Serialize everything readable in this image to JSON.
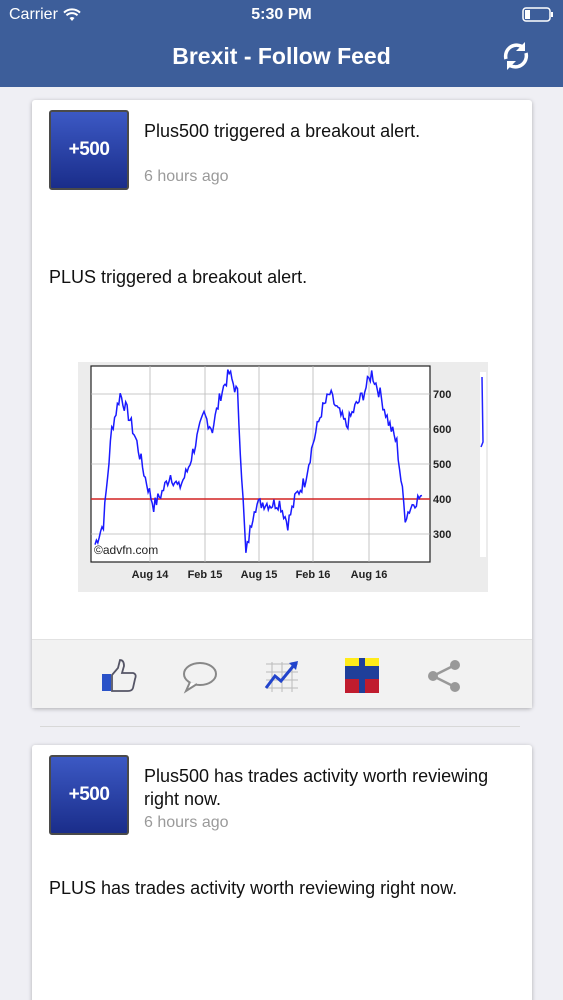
{
  "status": {
    "carrier": "Carrier",
    "time": "5:30 PM"
  },
  "nav": {
    "title": "Brexit - Follow Feed"
  },
  "feed": [
    {
      "logo_text": "+500",
      "headline": "Plus500 triggered a breakout alert.",
      "time": "6 hours ago",
      "body": "PLUS triggered a breakout alert.",
      "chart": {
        "watermark": "©advfn.com",
        "x_labels": [
          "Aug 14",
          "Feb 15",
          "Aug 15",
          "Feb 16",
          "Aug 16"
        ],
        "y_labels": [
          "700",
          "600",
          "500",
          "400",
          "300"
        ]
      }
    },
    {
      "logo_text": "+500",
      "headline": "Plus500 has trades activity worth reviewing right now.",
      "time": "6 hours ago",
      "body": "PLUS has trades activity worth reviewing right now."
    }
  ],
  "chart_data": {
    "type": "line",
    "x": [
      "Aug 14",
      "Feb 15",
      "Aug 15",
      "Feb 16",
      "Aug 16"
    ],
    "ylim": [
      220,
      780
    ],
    "reference_line": 400,
    "colors": {
      "line": "#1a1aff",
      "reference": "#d22222"
    },
    "series": [
      {
        "values": [
          270,
          330,
          600,
          700,
          640,
          560,
          460,
          380,
          420,
          470,
          430,
          480,
          560,
          640,
          600,
          700,
          760,
          700,
          240,
          380,
          390,
          385,
          390,
          330,
          410,
          450,
          560,
          650,
          700,
          650,
          610,
          660,
          700,
          760,
          700,
          620,
          560,
          350,
          390,
          410
        ]
      }
    ]
  },
  "colors": {
    "nav_bg": "#3d5e9a"
  },
  "icons": [
    "thumbs-up-icon",
    "comment-icon",
    "chart-icon",
    "bar-icon",
    "share-icon"
  ]
}
